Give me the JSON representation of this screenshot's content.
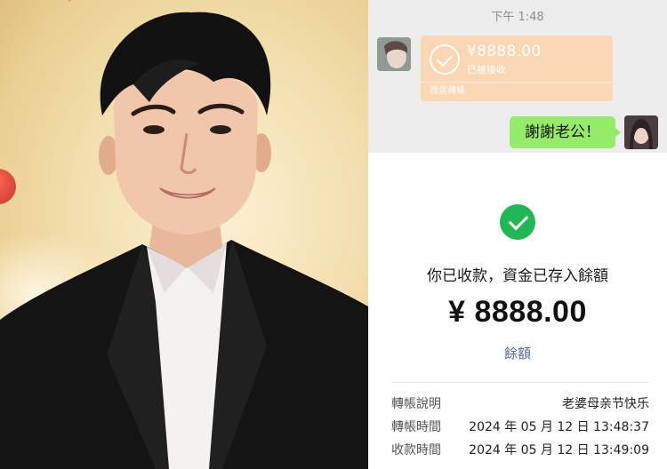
{
  "chat": {
    "time": "下午 1:48",
    "transfer_card": {
      "amount": "¥8888.00",
      "status": "已被接收",
      "footer": "微信轉帳"
    },
    "reply_bubble": "謝謝老公！"
  },
  "receipt": {
    "message": "你已收款，資金已存入餘額",
    "amount": "¥ 8888.00",
    "balance_link": "餘額",
    "details": [
      {
        "label": "轉帳說明",
        "value": "老婆母亲节快乐"
      },
      {
        "label": "轉帳時間",
        "value": "2024 年 05 月 12 日 13:48:37"
      },
      {
        "label": "收款時間",
        "value": "2024 年 05 月 12 日 13:49:09"
      }
    ]
  },
  "colors": {
    "chat_bg": "#ededed",
    "transfer_card": "#fbd8b3",
    "reply_bubble": "#95ec69",
    "success_green": "#1fb855",
    "link_blue": "#576b95"
  },
  "icons": [
    "check-circle-icon",
    "success-check-icon"
  ]
}
